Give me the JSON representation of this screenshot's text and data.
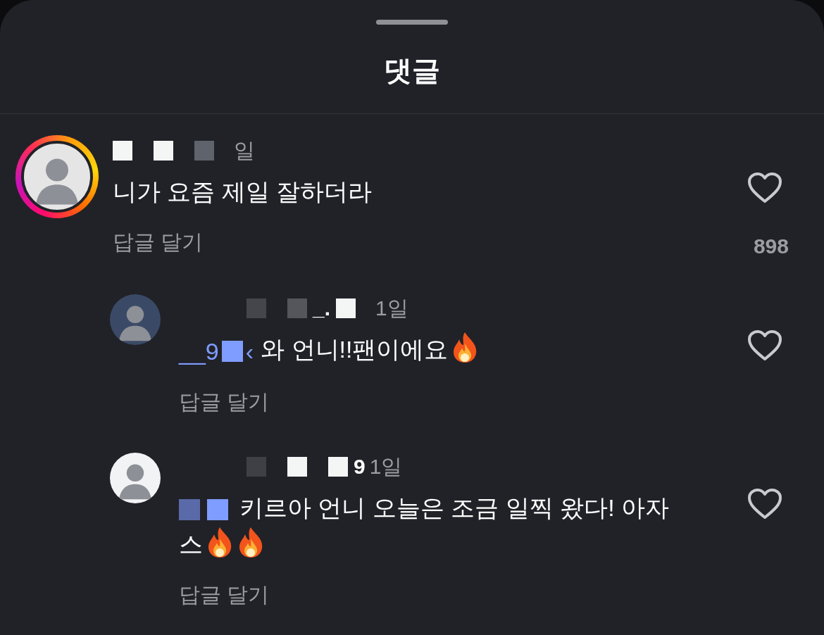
{
  "sheet": {
    "title": "댓글"
  },
  "comments": [
    {
      "avatar": {
        "story_ring": true,
        "color": "#e5e5e5"
      },
      "username": [
        {
          "kind": "block",
          "color": "#f4f5f5"
        },
        {
          "kind": "block",
          "color": "#f4f5f5"
        },
        {
          "kind": "block",
          "color": "#5f636b"
        }
      ],
      "time": "일",
      "body": [
        {
          "kind": "text",
          "text": "니가 요즘 제일 잘하더라"
        }
      ],
      "reply": "답글 달기",
      "likes": "898",
      "liked": false
    },
    {
      "avatar": {
        "story_ring": false,
        "color": "#3a4a66"
      },
      "username": [
        {
          "kind": "block",
          "color": "#45464b"
        },
        {
          "kind": "block",
          "color": "#55565b"
        },
        {
          "kind": "text",
          "text": "_."
        },
        {
          "kind": "block",
          "color": "#f4f5f5"
        }
      ],
      "time": "1일",
      "mention": [
        {
          "kind": "text",
          "text": "__9"
        },
        {
          "kind": "block",
          "color": "#7f9cff"
        },
        {
          "kind": "text",
          "text": "‹"
        }
      ],
      "body": [
        {
          "kind": "text",
          "text": "와 언니!!팬이에요"
        },
        {
          "kind": "flame"
        }
      ],
      "reply": "답글 달기",
      "liked": false
    },
    {
      "avatar": {
        "story_ring": false,
        "color": "#f2f3f5"
      },
      "username": [
        {
          "kind": "block",
          "color": "#3f4045"
        },
        {
          "kind": "block",
          "color": "#f4f5f5"
        },
        {
          "kind": "block",
          "color": "#f4f5f5"
        },
        {
          "kind": "text",
          "text": "9"
        }
      ],
      "time": "1일",
      "mention": [
        {
          "kind": "block",
          "color": "#5a6aa8"
        },
        {
          "kind": "block",
          "color": "#7f9cff"
        }
      ],
      "body": [
        {
          "kind": "text",
          "text": "키르아 언니 오늘은 조금 일찍 왔다! 아자스"
        },
        {
          "kind": "flame"
        },
        {
          "kind": "flame"
        }
      ],
      "reply": "답글 달기",
      "liked": false
    }
  ]
}
